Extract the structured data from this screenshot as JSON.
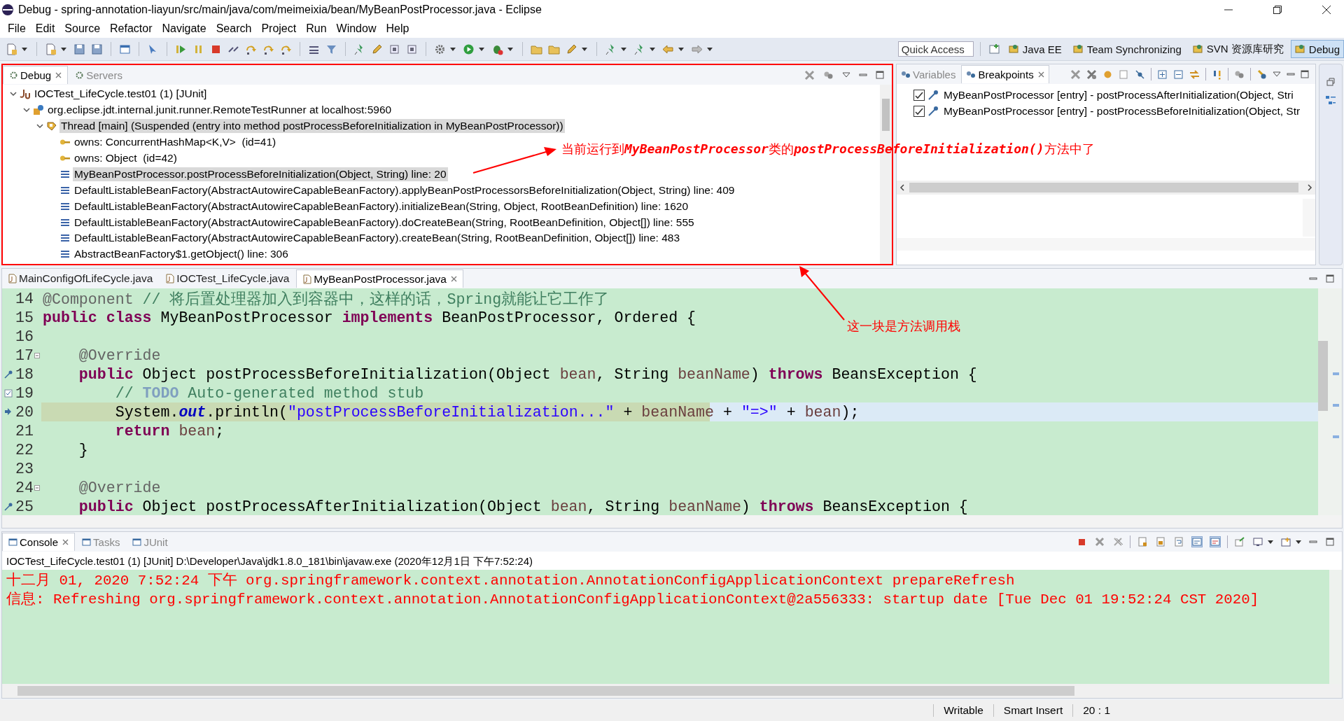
{
  "window": {
    "title": "Debug - spring-annotation-liayun/src/main/java/com/meimeixia/bean/MyBeanPostProcessor.java - Eclipse"
  },
  "menu": [
    "File",
    "Edit",
    "Source",
    "Refactor",
    "Navigate",
    "Search",
    "Project",
    "Run",
    "Window",
    "Help"
  ],
  "quick_access": {
    "placeholder": "Quick Access"
  },
  "perspectives": [
    {
      "label": "Java EE",
      "selected": false
    },
    {
      "label": "Team Synchronizing",
      "selected": false
    },
    {
      "label": "SVN 资源库研究",
      "selected": false
    },
    {
      "label": "Debug",
      "selected": true
    }
  ],
  "debug_view": {
    "tabs": [
      {
        "label": "Debug",
        "selected": true
      },
      {
        "label": "Servers",
        "selected": false
      }
    ],
    "tree": [
      {
        "label": "IOCTest_LifeCycle.test01 (1) [JUnit]",
        "kind": "launch",
        "expanded": true,
        "selected": false,
        "children": [
          {
            "label": "org.eclipse.jdt.internal.junit.runner.RemoteTestRunner at localhost:5960",
            "kind": "target",
            "expanded": true,
            "selected": false,
            "children": [
              {
                "label": "Thread [main] (Suspended (entry into method postProcessBeforeInitialization in MyBeanPostProcessor))",
                "kind": "thread",
                "expanded": true,
                "selected": true,
                "children": [
                  {
                    "label": "owns: ConcurrentHashMap<K,V>  (id=41)",
                    "kind": "monitor",
                    "selected": false
                  },
                  {
                    "label": "owns: Object  (id=42)",
                    "kind": "monitor",
                    "selected": false
                  },
                  {
                    "label": "MyBeanPostProcessor.postProcessBeforeInitialization(Object, String) line: 20",
                    "kind": "frame",
                    "selected": true
                  },
                  {
                    "label": "DefaultListableBeanFactory(AbstractAutowireCapableBeanFactory).applyBeanPostProcessorsBeforeInitialization(Object, String) line: 409",
                    "kind": "frame",
                    "selected": false
                  },
                  {
                    "label": "DefaultListableBeanFactory(AbstractAutowireCapableBeanFactory).initializeBean(String, Object, RootBeanDefinition) line: 1620",
                    "kind": "frame",
                    "selected": false
                  },
                  {
                    "label": "DefaultListableBeanFactory(AbstractAutowireCapableBeanFactory).doCreateBean(String, RootBeanDefinition, Object[]) line: 555",
                    "kind": "frame",
                    "selected": false
                  },
                  {
                    "label": "DefaultListableBeanFactory(AbstractAutowireCapableBeanFactory).createBean(String, RootBeanDefinition, Object[]) line: 483",
                    "kind": "frame",
                    "selected": false
                  },
                  {
                    "label": "AbstractBeanFactory$1.getObject() line: 306",
                    "kind": "frame",
                    "selected": false
                  }
                ]
              }
            ]
          }
        ]
      }
    ]
  },
  "breakpoints_view": {
    "tabs": [
      {
        "label": "Variables",
        "selected": false
      },
      {
        "label": "Breakpoints",
        "selected": true
      }
    ],
    "breakpoints": [
      {
        "label": "MyBeanPostProcessor [entry] - postProcessAfterInitialization(Object, Stri",
        "checked": true
      },
      {
        "label": "MyBeanPostProcessor [entry] - postProcessBeforeInitialization(Object, Str",
        "checked": true
      }
    ]
  },
  "editor": {
    "tabs": [
      {
        "label": "MainConfigOfLifeCycle.java",
        "selected": false
      },
      {
        "label": "IOCTest_LifeCycle.java",
        "selected": false
      },
      {
        "label": "MyBeanPostProcessor.java",
        "selected": true
      }
    ],
    "lines": [
      {
        "number": "14",
        "current": false,
        "tokens": [
          {
            "t": "@Component",
            "kind": "annotation"
          },
          {
            "t": " // 将后置处理器加入到容器中，这样的话，Spring就能让它工作了",
            "kind": "comment"
          }
        ]
      },
      {
        "number": "15",
        "current": false,
        "tokens": [
          {
            "t": "public class",
            "kind": "keyword"
          },
          {
            "t": " MyBeanPostProcessor ",
            "kind": "plain"
          },
          {
            "t": "implements",
            "kind": "keyword"
          },
          {
            "t": " BeanPostProcessor, Ordered {",
            "kind": "plain"
          }
        ]
      },
      {
        "number": "16",
        "current": false
      },
      {
        "number": "17",
        "current": false,
        "kind": "fold",
        "tokens": [
          {
            "t": "    @Override",
            "kind": "annotation"
          }
        ]
      },
      {
        "number": "18",
        "current": false,
        "kind": "breakpoint",
        "tokens": [
          {
            "t": "    public",
            "kind": "keyword"
          },
          {
            "t": " Object postProcessBeforeInitialization(Object ",
            "kind": "plain"
          },
          {
            "t": "bean",
            "kind": "param"
          },
          {
            "t": ", String ",
            "kind": "plain"
          },
          {
            "t": "beanName",
            "kind": "param"
          },
          {
            "t": ") ",
            "kind": "plain"
          },
          {
            "t": "throws",
            "kind": "keyword"
          },
          {
            "t": " BeansException {",
            "kind": "plain"
          }
        ]
      },
      {
        "number": "19",
        "current": false,
        "kind": "task",
        "tokens": [
          {
            "t": "        // ",
            "kind": "comment"
          },
          {
            "t": "TODO",
            "kind": "todo"
          },
          {
            "t": " Auto-generated method stub",
            "kind": "comment"
          }
        ]
      },
      {
        "number": "20",
        "current": true,
        "kind": "pointer",
        "tokens": [
          {
            "t": "        System.",
            "kind": "plain"
          },
          {
            "t": "out",
            "kind": "field"
          },
          {
            "t": ".println(",
            "kind": "plain"
          },
          {
            "t": "\"postProcessBeforeInitialization...\"",
            "kind": "string"
          },
          {
            "t": " + ",
            "kind": "plain"
          },
          {
            "t": "beanName",
            "kind": "param"
          },
          {
            "t": " + ",
            "kind": "plain"
          },
          {
            "t": "\"=>\"",
            "kind": "string"
          },
          {
            "t": " + ",
            "kind": "plain"
          },
          {
            "t": "bean",
            "kind": "param"
          },
          {
            "t": ");",
            "kind": "plain"
          }
        ]
      },
      {
        "number": "21",
        "current": false,
        "tokens": [
          {
            "t": "        return",
            "kind": "keyword"
          },
          {
            "t": " bean",
            "kind": "param"
          },
          {
            "t": ";",
            "kind": "plain"
          }
        ]
      },
      {
        "number": "22",
        "current": false,
        "tokens": [
          {
            "t": "    }",
            "kind": "plain"
          }
        ]
      },
      {
        "number": "23",
        "current": false
      },
      {
        "number": "24",
        "current": false,
        "kind": "fold",
        "tokens": [
          {
            "t": "    @Override",
            "kind": "annotation"
          }
        ]
      },
      {
        "number": "25",
        "current": false,
        "kind": "breakpoint",
        "tokens": [
          {
            "t": "    public",
            "kind": "keyword"
          },
          {
            "t": " Object postProcessAfterInitialization(Object ",
            "kind": "plain"
          },
          {
            "t": "bean",
            "kind": "param"
          },
          {
            "t": ", String ",
            "kind": "plain"
          },
          {
            "t": "beanName",
            "kind": "param"
          },
          {
            "t": ") ",
            "kind": "plain"
          },
          {
            "t": "throws",
            "kind": "keyword"
          },
          {
            "t": " BeansException {",
            "kind": "plain"
          }
        ]
      }
    ]
  },
  "console": {
    "tabs": [
      {
        "label": "Console",
        "selected": true
      },
      {
        "label": "Tasks",
        "selected": false
      },
      {
        "label": "JUnit",
        "selected": false
      }
    ],
    "process": "IOCTest_LifeCycle.test01 (1) [JUnit] D:\\Developer\\Java\\jdk1.8.0_181\\bin\\javaw.exe (2020年12月1日 下午7:52:24)",
    "lines": [
      "十二月 01, 2020 7:52:24 下午 org.springframework.context.annotation.AnnotationConfigApplicationContext prepareRefresh",
      "信息: Refreshing org.springframework.context.annotation.AnnotationConfigApplicationContext@2a556333: startup date [Tue Dec 01 19:52:24 CST 2020]"
    ]
  },
  "status_bar": [
    "Writable",
    "Smart Insert",
    "20 : 1"
  ],
  "annotations": [
    {
      "text": "当前运行到**MyBeanPostProcessor**类的**postProcessBeforeInitialization()**方法中了"
    },
    {
      "text": "这一块是方法调用栈"
    }
  ]
}
